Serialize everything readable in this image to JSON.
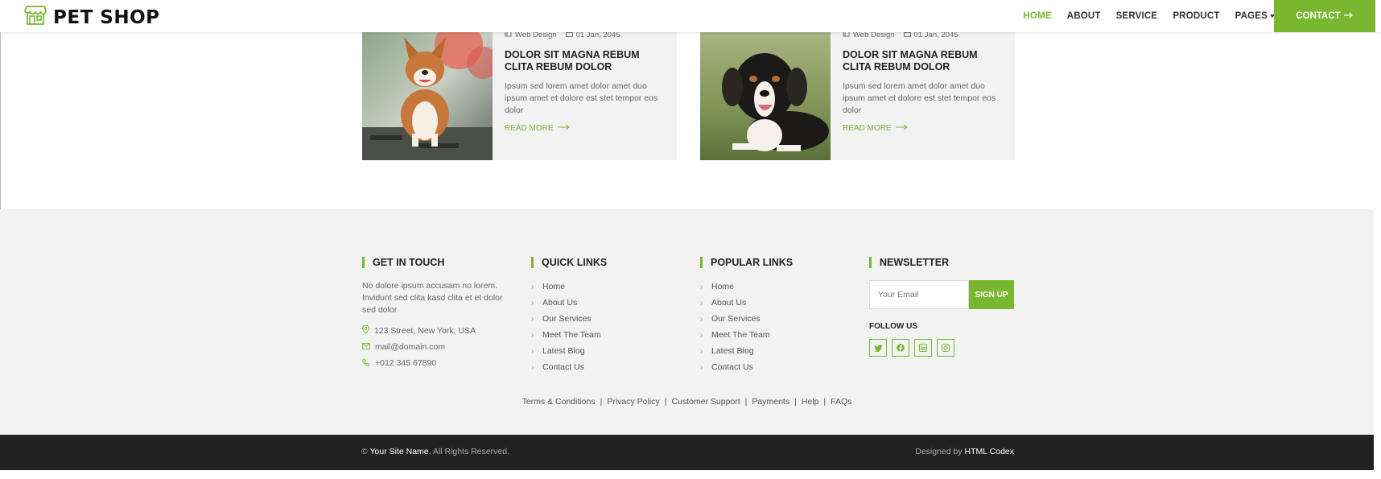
{
  "navbar": {
    "brand": "PET SHOP",
    "items": [
      {
        "label": "HOME",
        "active": true
      },
      {
        "label": "ABOUT",
        "active": false
      },
      {
        "label": "SERVICE",
        "active": false
      },
      {
        "label": "PRODUCT",
        "active": false
      },
      {
        "label": "PAGES",
        "active": false,
        "dropdown": true
      }
    ],
    "contact_label": "CONTACT",
    "accent_color": "#7ab730"
  },
  "blog": {
    "cards": [
      {
        "image": "corgi-photo",
        "category": "Web Design",
        "date": "01 Jan, 2045",
        "title": "DOLOR SIT MAGNA REBUM CLITA REBUM DOLOR",
        "text": "Ipsum sed lorem amet dolor amet duo ipsum amet et dolore est stet tempor eos dolor",
        "read_more": "READ MORE"
      },
      {
        "image": "bernese-dog-photo",
        "category": "Web Design",
        "date": "01 Jan, 2045",
        "title": "DOLOR SIT MAGNA REBUM CLITA REBUM DOLOR",
        "text": "Ipsum sed lorem amet dolor amet duo ipsum amet et dolore est stet tempor eos dolor",
        "read_more": "READ MORE"
      }
    ]
  },
  "footer": {
    "get_in_touch": {
      "title": "GET IN TOUCH",
      "text": "No dolore ipsum accusam no lorem. Invidunt sed clita kasd clita et et dolor sed dolor",
      "address": "123 Street, New York, USA",
      "email": "mail@domain.com",
      "phone": "+012 345 67890"
    },
    "quick_links": {
      "title": "QUICK LINKS",
      "items": [
        "Home",
        "About Us",
        "Our Services",
        "Meet The Team",
        "Latest Blog",
        "Contact Us"
      ]
    },
    "popular_links": {
      "title": "POPULAR LINKS",
      "items": [
        "Home",
        "About Us",
        "Our Services",
        "Meet The Team",
        "Latest Blog",
        "Contact Us"
      ]
    },
    "newsletter": {
      "title": "NEWSLETTER",
      "placeholder": "Your Email",
      "button": "SIGN UP",
      "follow_title": "FOLLOW US",
      "social": [
        "twitter-icon",
        "facebook-icon",
        "linkedin-icon",
        "instagram-icon"
      ]
    },
    "bottom_links": [
      "Terms & Conditions",
      "Privacy Policy",
      "Customer Support",
      "Payments",
      "Help",
      "FAQs"
    ],
    "copyright": {
      "prefix": "©",
      "site_name": "Your Site Name",
      "suffix": ". All Rights Reserved.",
      "designed_by_label": "Designed by",
      "designer": "HTML Codex"
    }
  }
}
